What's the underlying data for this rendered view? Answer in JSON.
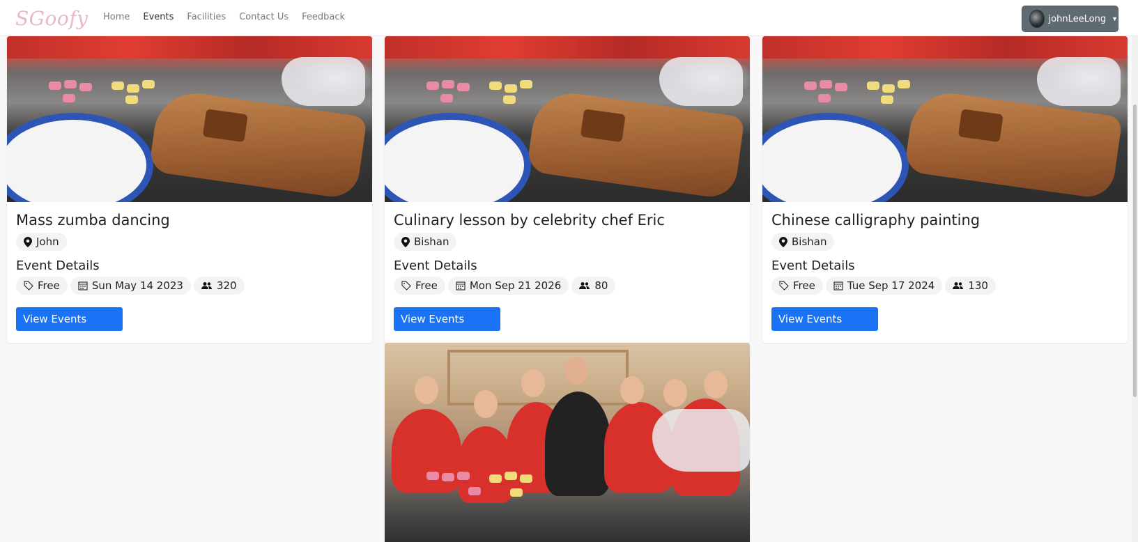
{
  "navbar": {
    "brand": "SGoofy",
    "links": [
      "Home",
      "Events",
      "Facilities",
      "Contact Us",
      "Feedback"
    ],
    "active": "Events",
    "user": {
      "name": "johnLeeLong"
    }
  },
  "events": [
    {
      "title": "Mass zumba dancing",
      "location": "John",
      "details_label": "Event Details",
      "price": "Free",
      "date": "Sun May 14 2023",
      "capacity": "320",
      "button": "View Events"
    },
    {
      "title": "Culinary lesson by celebrity chef Eric",
      "location": "Bishan",
      "details_label": "Event Details",
      "price": "Free",
      "date": "Mon Sep 21 2026",
      "capacity": "80",
      "button": "View Events"
    },
    {
      "title": "Chinese calligraphy painting",
      "location": "Bishan",
      "details_label": "Event Details",
      "price": "Free",
      "date": "Tue Sep 17 2024",
      "capacity": "130",
      "button": "View Events"
    }
  ],
  "colors": {
    "brand": "#e9b8c6",
    "primary_button": "#1a73f5",
    "user_button": "#5f6b72"
  }
}
